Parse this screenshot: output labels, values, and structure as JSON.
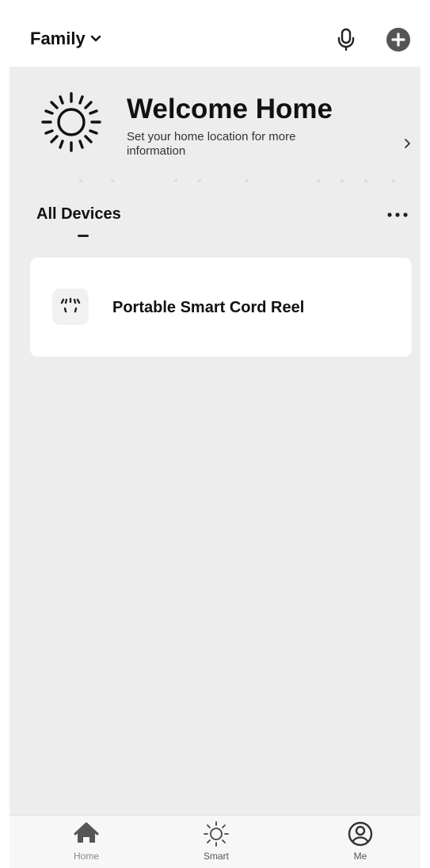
{
  "header": {
    "home_selector_label": "Family",
    "icons": [
      "chevron-down-icon",
      "microphone-icon",
      "add-circle-icon"
    ]
  },
  "welcome": {
    "title": "Welcome Home",
    "subtitle": "Set your home location for more information",
    "icon": "sun-icon",
    "arrow_icon": "chevron-right-icon"
  },
  "devices": {
    "section_title": "All Devices",
    "more_icon": "more-dots-icon",
    "items": [
      {
        "name": "Portable Smart Cord Reel",
        "icon": "smart-plug-icon"
      }
    ]
  },
  "bottom_nav": {
    "items": [
      {
        "label": "Home",
        "icon": "home-icon"
      },
      {
        "label": "Smart",
        "icon": "sun-icon"
      },
      {
        "label": "Me",
        "icon": "profile-icon"
      }
    ]
  },
  "colors": {
    "background": "#ededed",
    "card": "#ffffff",
    "text": "#111111"
  }
}
